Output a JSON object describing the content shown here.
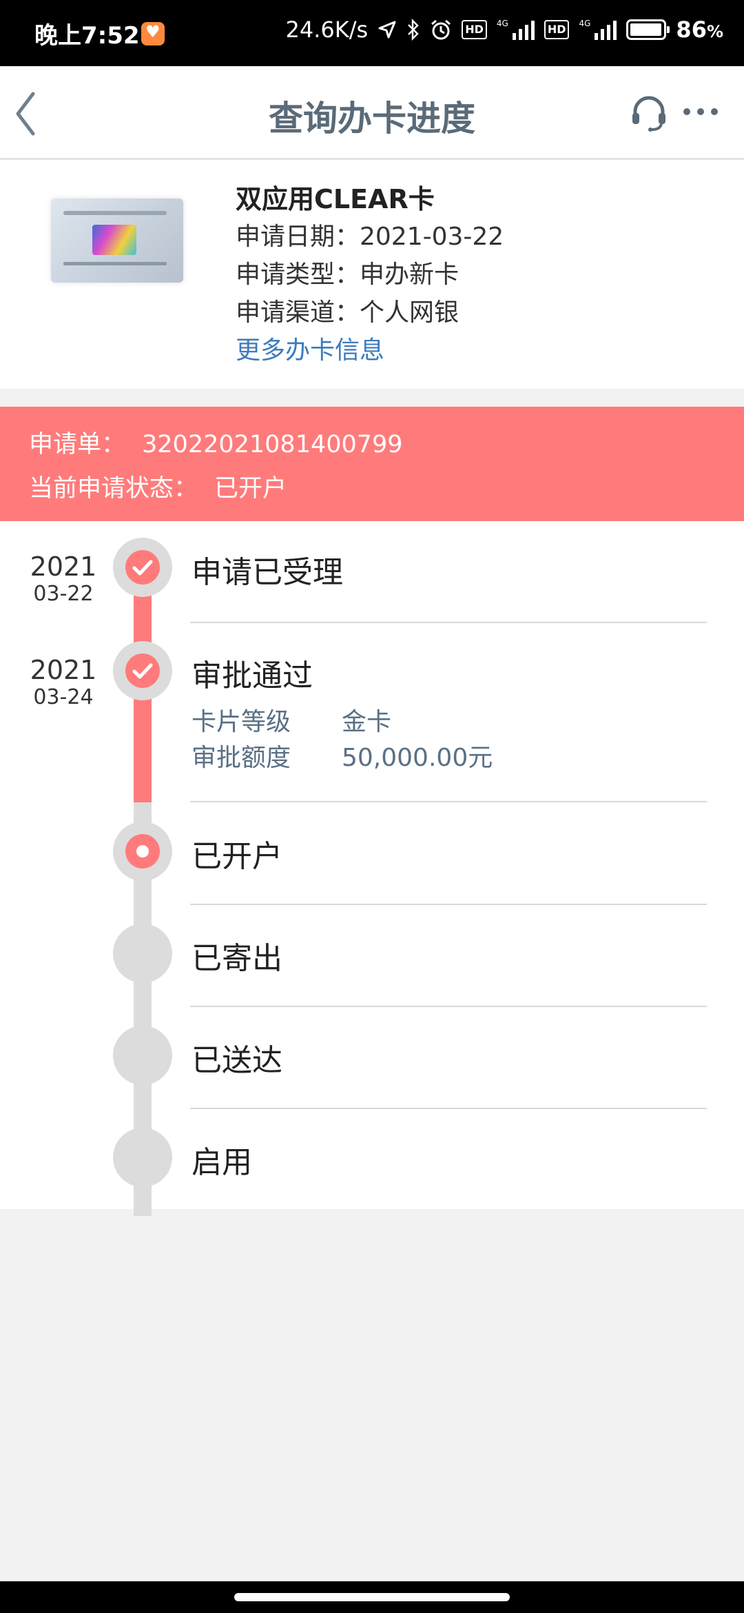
{
  "status_bar": {
    "time": "晚上7:52",
    "net_speed": "24.6K/s",
    "sim1_tag": "HD",
    "sim1_net": "4G",
    "sim2_tag": "HD",
    "sim2_net": "4G",
    "battery": "86",
    "battery_unit": "%"
  },
  "header": {
    "title": "查询办卡进度",
    "back_icon": "chevron-left-icon",
    "support_icon": "headset-icon",
    "more_icon": "more-dots-icon"
  },
  "card": {
    "name": "双应用CLEAR卡",
    "apply_date": "申请日期：2021-03-22",
    "apply_type": "申请类型：申办新卡",
    "apply_channel": "申请渠道：个人网银",
    "more_link": "更多办卡信息"
  },
  "banner": {
    "order_label": "申请单：",
    "order_no": "32022021081400799",
    "status_label": "当前申请状态：",
    "status_value": "已开户",
    "color": "#ff7b7b"
  },
  "timeline": {
    "steps": [
      {
        "title": "申请已受理",
        "year": "2021",
        "date": "03-22",
        "state": "done"
      },
      {
        "title": "审批通过",
        "year": "2021",
        "date": "03-24",
        "state": "done",
        "details": [
          {
            "label": "卡片等级",
            "value": "金卡"
          },
          {
            "label": "审批额度",
            "value": "50,000.00元"
          }
        ]
      },
      {
        "title": "已开户",
        "state": "current"
      },
      {
        "title": "已寄出",
        "state": "pending"
      },
      {
        "title": "已送达",
        "state": "pending"
      },
      {
        "title": "启用",
        "state": "pending"
      }
    ]
  }
}
